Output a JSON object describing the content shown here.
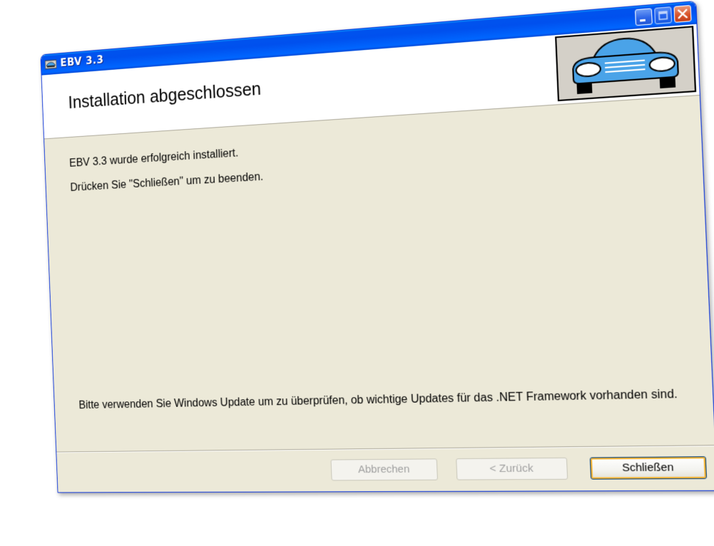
{
  "window": {
    "title": "EBV 3.3",
    "icon": "car-app-icon"
  },
  "caption_buttons": {
    "minimize_icon": "minimize-icon",
    "maximize_icon": "maximize-icon",
    "close_icon": "close-icon"
  },
  "header": {
    "title": "Installation abgeschlossen",
    "logo_icon": "car-logo-icon"
  },
  "body": {
    "installed_text": "EBV 3.3  wurde erfolgreich installiert.",
    "press_close_text": "Drücken Sie \"Schließen\" um zu beenden.",
    "update_text": "Bitte verwenden Sie Windows Update um zu überprüfen, ob wichtige Updates für das .NET Framework vorhanden sind."
  },
  "buttons": {
    "cancel_label": "Abbrechen",
    "cancel_enabled": false,
    "back_label": "< Zurück",
    "back_enabled": false,
    "finish_label": "Schließen",
    "finish_enabled": true
  },
  "colors": {
    "titlebar": "#0054e3",
    "window_body": "#ece9d8",
    "close_button": "#d9542a",
    "logo_car": "#4aa3e8",
    "focus_ring": "#f8b636"
  }
}
